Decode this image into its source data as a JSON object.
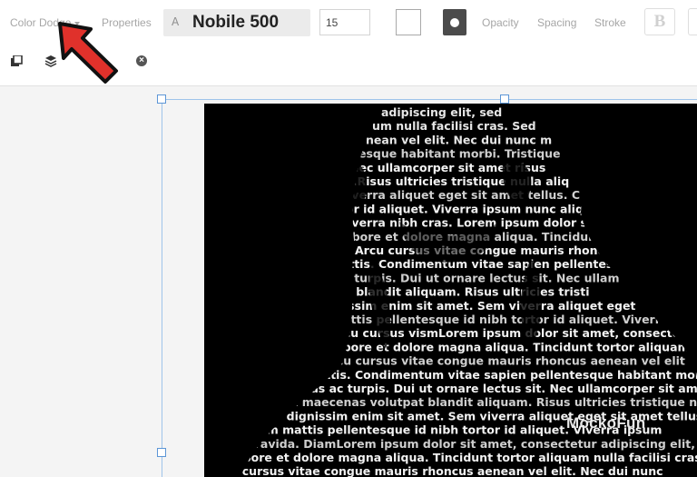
{
  "toolbar": {
    "blend_mode": "Color Dodge",
    "properties_label": "Properties",
    "font_icon_glyph": "A",
    "font_name": "Nobile 500",
    "font_size": "15",
    "opacity_label": "Opacity",
    "spacing_label": "Spacing",
    "stroke_label": "Stroke",
    "bold_label": "B",
    "close_glyph": "×"
  },
  "canvas": {
    "watermark": "MockoFun",
    "text_lines": [
      "adipiscing elit, sed",
      "um nulla facilisi cras. Sed",
      "nean vel elit. Nec dui nunc m",
      "esque habitant morbi. Tristique",
      "Nec ullamcorper sit amet risus",
      "n.Risus ultricies tristique nulla aliq",
      "viverra aliquet eget sit amet tellus. C",
      "tor id aliquet. Viverra ipsum nunc aliq",
      "viverra nibh cras. Lorem ipsum dolor sit",
      "labore et dolore magna aliqua. Tincidunt",
      "n. Arcu cursus vitae congue mauris rhoncus",
      "gittis. Condimentum vitae sapien pellentesque",
      "ac turpis. Dui ut ornare lectus sit. Nec ullam",
      "ut blandit aliquam. Risus ultricies tristi",
      "nissim enim sit amet. Sem viverra aliquet eget",
      "mattis pellentesque id nibh tortor id aliquet. Viverra",
      "Arcu cursus vismLorem ipsum dolor sit amet, consectetur",
      "labore et dolore magna aliqua. Tincidunt tortor aliquam",
      "Arcu cursus vitae congue mauris rhoncus aenean vel elit",
      "gittis. Condimentum vitae sapien pellentesque habitant morbi",
      "enas ac turpis. Dui ut ornare lectus sit. Nec ullamcorper sit amet",
      "pat maecenas volutpat blandit aliquam. Risus ultricies tristique nulla",
      "que dignissim enim sit amet. Sem viverra aliquet eget sit amet tellus",
      "ntum mattis pellentesque id nibh tortor id aliquet. Viverra ipsum",
      "s gravida. DiamLorem ipsum dolor sit amet, consectetur adipiscing elit, se",
      "labore et dolore magna aliqua. Tincidunt tortor aliquam nulla facilisi cras",
      "c cursus vitae congue mauris rhoncus aenean vel elit. Nec dui nunc"
    ]
  },
  "colors": {
    "accent": "#5c96d6",
    "arrow_fill": "#e0312b"
  }
}
